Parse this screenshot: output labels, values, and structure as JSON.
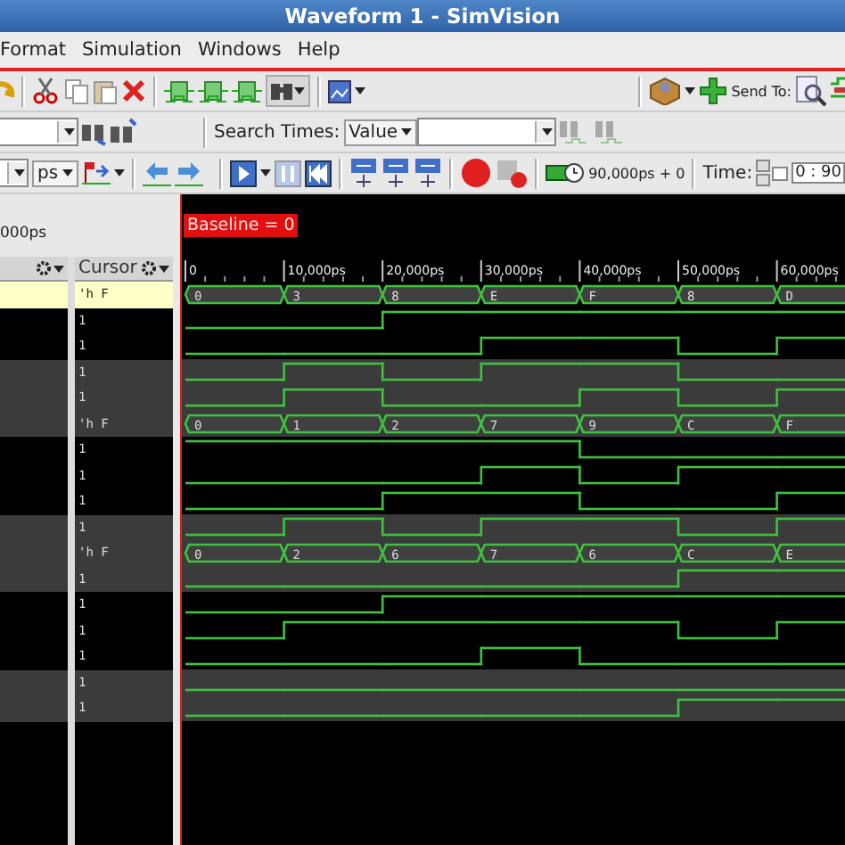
{
  "window": {
    "title": "Waveform 1 - SimVision"
  },
  "menu": [
    "Format",
    "Simulation",
    "Windows",
    "Help"
  ],
  "toolbar": {
    "send_to_label": "Send To:",
    "search_times_label": "Search Times:",
    "search_type": "Value",
    "time_unit": "ps",
    "sim_time": "90,000ps + 0",
    "time_label": "Time:",
    "time_value": "0 : 90"
  },
  "zoom_reading": "000ps",
  "baseline": "Baseline = 0",
  "cursor_header": "Cursor",
  "ruler": [
    "0",
    "10,000ps",
    "20,000ps",
    "30,000ps",
    "40,000ps",
    "50,000ps",
    "60,000ps"
  ],
  "signals": [
    {
      "kind": "bus",
      "cursor": "'h F",
      "highlighted": true,
      "shaded": false,
      "values": [
        "0",
        "3",
        "8",
        "E",
        "F",
        "8",
        "D"
      ]
    },
    {
      "kind": "bit",
      "cursor": "1",
      "highlighted": false,
      "shaded": false,
      "high": [
        false,
        false,
        true,
        true,
        true,
        true,
        true
      ]
    },
    {
      "kind": "bit",
      "cursor": "1",
      "highlighted": false,
      "shaded": false,
      "high": [
        false,
        false,
        false,
        true,
        true,
        false,
        true
      ]
    },
    {
      "kind": "bit",
      "cursor": "1",
      "highlighted": false,
      "shaded": true,
      "high": [
        false,
        true,
        false,
        true,
        true,
        false,
        false
      ]
    },
    {
      "kind": "bit",
      "cursor": "1",
      "highlighted": false,
      "shaded": true,
      "high": [
        false,
        true,
        false,
        false,
        true,
        false,
        true
      ]
    },
    {
      "kind": "bus",
      "cursor": "'h F",
      "highlighted": false,
      "shaded": true,
      "values": [
        "0",
        "1",
        "2",
        "7",
        "9",
        "C",
        "F"
      ]
    },
    {
      "kind": "bit",
      "cursor": "1",
      "highlighted": false,
      "shaded": false,
      "high": [
        true,
        true,
        true,
        true,
        false,
        false,
        false
      ]
    },
    {
      "kind": "bit",
      "cursor": "1",
      "highlighted": false,
      "shaded": false,
      "high": [
        false,
        false,
        false,
        true,
        false,
        true,
        true
      ]
    },
    {
      "kind": "bit",
      "cursor": "1",
      "highlighted": false,
      "shaded": false,
      "high": [
        false,
        false,
        true,
        true,
        false,
        false,
        true
      ]
    },
    {
      "kind": "bit",
      "cursor": "1",
      "highlighted": false,
      "shaded": true,
      "high": [
        false,
        true,
        false,
        true,
        true,
        false,
        true
      ]
    },
    {
      "kind": "bus",
      "cursor": "'h F",
      "highlighted": false,
      "shaded": true,
      "values": [
        "0",
        "2",
        "6",
        "7",
        "6",
        "C",
        "E"
      ]
    },
    {
      "kind": "bit",
      "cursor": "1",
      "highlighted": false,
      "shaded": true,
      "high": [
        false,
        false,
        false,
        false,
        false,
        true,
        true
      ]
    },
    {
      "kind": "bit",
      "cursor": "1",
      "highlighted": false,
      "shaded": false,
      "high": [
        false,
        false,
        true,
        true,
        true,
        true,
        true
      ]
    },
    {
      "kind": "bit",
      "cursor": "1",
      "highlighted": false,
      "shaded": false,
      "high": [
        false,
        true,
        true,
        true,
        true,
        false,
        true
      ]
    },
    {
      "kind": "bit",
      "cursor": "1",
      "highlighted": false,
      "shaded": false,
      "high": [
        false,
        false,
        false,
        true,
        false,
        false,
        false
      ]
    },
    {
      "kind": "bit",
      "cursor": "1",
      "highlighted": false,
      "shaded": true,
      "high": [
        false,
        false,
        false,
        false,
        false,
        false,
        false
      ]
    },
    {
      "kind": "bit",
      "cursor": "1",
      "highlighted": false,
      "shaded": true,
      "high": [
        false,
        false,
        false,
        false,
        false,
        true,
        true
      ]
    }
  ]
}
